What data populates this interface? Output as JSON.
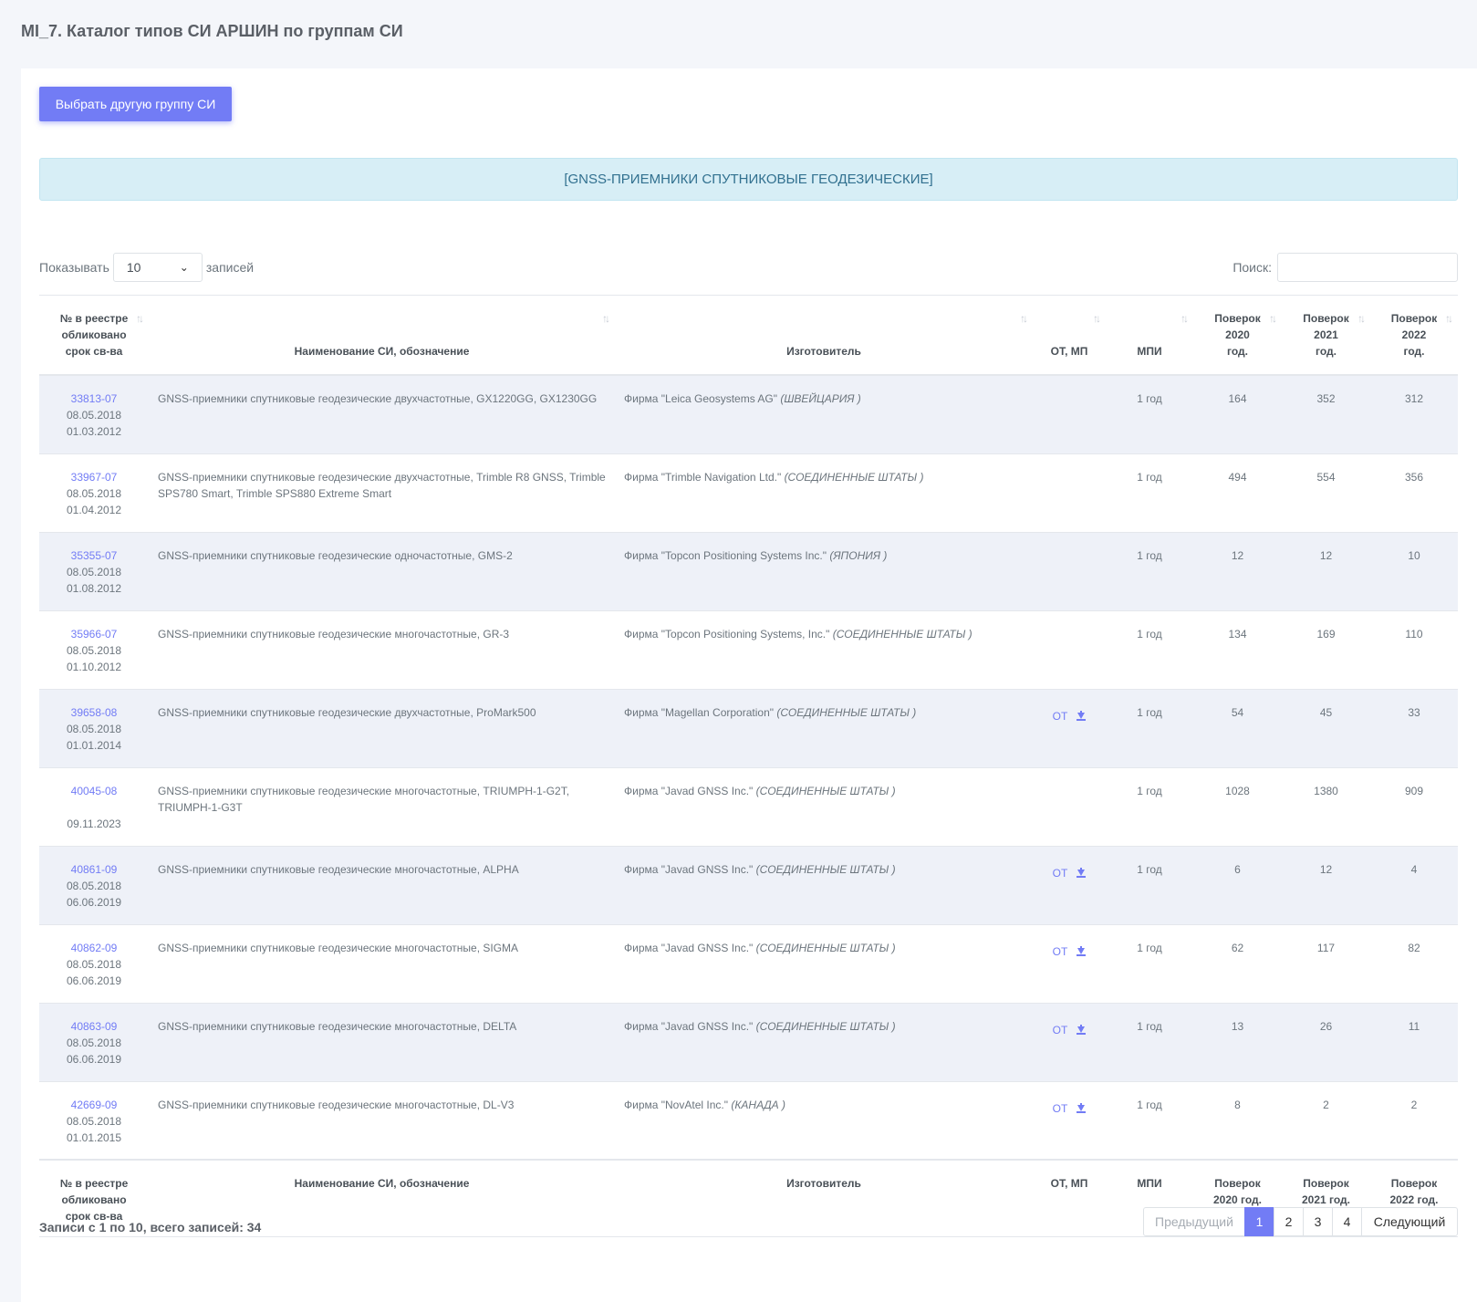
{
  "page_title": "MI_7. Каталог типов СИ АРШИН по группам СИ",
  "choose_button": "Выбрать другую группу СИ",
  "group_banner": "[GNSS-ПРИЕМНИКИ СПУТНИКОВЫЕ ГЕОДЕЗИЧЕСКИЕ]",
  "length": {
    "show_label": "Показывать",
    "value": "10",
    "entries_label": "записей"
  },
  "search": {
    "label": "Поиск:",
    "value": ""
  },
  "columns": {
    "reg_line1": "№ в реестре",
    "reg_line2": "обликовано",
    "reg_line3": "срок св-ва",
    "name": "Наименование СИ, обозначение",
    "maker": "Изготовитель",
    "ot": "ОТ, МП",
    "mpi": "МПИ",
    "p2020_line1": "Поверок",
    "p2020_line2": "2020",
    "p2020_line3": "год.",
    "p2021_line1": "Поверок",
    "p2021_line2": "2021",
    "p2021_line3": "год.",
    "p2022_line1": "Поверок",
    "p2022_line2": "2022",
    "p2022_line3": "год.",
    "foot_p2020": "2020 год.",
    "foot_p2021": "2021 год.",
    "foot_p2022": "2022 год."
  },
  "rows": [
    {
      "reg": "33813-07",
      "published": "08.05.2018",
      "valid": "01.03.2012",
      "name": "GNSS-приемники спутниковые геодезические двухчастотные, GX1220GG, GX1230GG",
      "maker": "Фирма \"Leica Geosystems AG\"",
      "country": "(ШВЕЙЦАРИЯ )",
      "ot": "",
      "mpi": "1 год",
      "p2020": "164",
      "p2021": "352",
      "p2022": "312"
    },
    {
      "reg": "33967-07",
      "published": "08.05.2018",
      "valid": "01.04.2012",
      "name": "GNSS-приемники спутниковые геодезические двухчастотные, Trimble R8 GNSS, Trimble SPS780 Smart, Trimble SPS880 Extreme Smart",
      "maker": "Фирма \"Trimble Navigation Ltd.\"",
      "country": "(СОЕДИНЕННЫЕ ШТАТЫ )",
      "ot": "",
      "mpi": "1 год",
      "p2020": "494",
      "p2021": "554",
      "p2022": "356"
    },
    {
      "reg": "35355-07",
      "published": "08.05.2018",
      "valid": "01.08.2012",
      "name": "GNSS-приемники спутниковые геодезические одночастотные, GMS-2",
      "maker": "Фирма \"Topcon Positioning Systems Inc.\"",
      "country": "(ЯПОНИЯ )",
      "ot": "",
      "mpi": "1 год",
      "p2020": "12",
      "p2021": "12",
      "p2022": "10"
    },
    {
      "reg": "35966-07",
      "published": "08.05.2018",
      "valid": "01.10.2012",
      "name": "GNSS-приемники спутниковые геодезические многочастотные, GR-3",
      "maker": "Фирма \"Topcon Positioning Systems, Inc.\"",
      "country": "(СОЕДИНЕННЫЕ ШТАТЫ )",
      "ot": "",
      "mpi": "1 год",
      "p2020": "134",
      "p2021": "169",
      "p2022": "110"
    },
    {
      "reg": "39658-08",
      "published": "08.05.2018",
      "valid": "01.01.2014",
      "name": "GNSS-приемники спутниковые геодезические двухчастотные, ProMark500",
      "maker": "Фирма \"Magellan Corporation\"",
      "country": "(СОЕДИНЕННЫЕ ШТАТЫ )",
      "ot": "ОТ",
      "mpi": "1 год",
      "p2020": "54",
      "p2021": "45",
      "p2022": "33"
    },
    {
      "reg": "40045-08",
      "published": "",
      "valid": "09.11.2023",
      "name": "GNSS-приемники спутниковые геодезические многочастотные, TRIUMPH-1-G2T, TRIUMPH-1-G3T",
      "maker": "Фирма \"Javad GNSS Inc.\"",
      "country": "(СОЕДИНЕННЫЕ ШТАТЫ )",
      "ot": "",
      "mpi": "1 год",
      "p2020": "1028",
      "p2021": "1380",
      "p2022": "909"
    },
    {
      "reg": "40861-09",
      "published": "08.05.2018",
      "valid": "06.06.2019",
      "name": "GNSS-приемники спутниковые геодезические многочастотные, ALPHA",
      "maker": "Фирма \"Javad GNSS Inc.\"",
      "country": "(СОЕДИНЕННЫЕ ШТАТЫ )",
      "ot": "ОТ",
      "mpi": "1 год",
      "p2020": "6",
      "p2021": "12",
      "p2022": "4"
    },
    {
      "reg": "40862-09",
      "published": "08.05.2018",
      "valid": "06.06.2019",
      "name": "GNSS-приемники спутниковые геодезические многочастотные, SIGMA",
      "maker": "Фирма \"Javad GNSS Inc.\"",
      "country": "(СОЕДИНЕННЫЕ ШТАТЫ )",
      "ot": "ОТ",
      "mpi": "1 год",
      "p2020": "62",
      "p2021": "117",
      "p2022": "82"
    },
    {
      "reg": "40863-09",
      "published": "08.05.2018",
      "valid": "06.06.2019",
      "name": "GNSS-приемники спутниковые геодезические многочастотные, DELTA",
      "maker": "Фирма \"Javad GNSS Inc.\"",
      "country": "(СОЕДИНЕННЫЕ ШТАТЫ )",
      "ot": "ОТ",
      "mpi": "1 год",
      "p2020": "13",
      "p2021": "26",
      "p2022": "11"
    },
    {
      "reg": "42669-09",
      "published": "08.05.2018",
      "valid": "01.01.2015",
      "name": "GNSS-приемники спутниковые геодезические многочастотные, DL-V3",
      "maker": "Фирма \"NovAtel Inc.\"",
      "country": "(КАНАДА )",
      "ot": "ОТ",
      "mpi": "1 год",
      "p2020": "8",
      "p2021": "2",
      "p2022": "2"
    }
  ],
  "info_text": "Записи с 1 по 10, всего записей: 34",
  "pagination": {
    "prev": "Предыдущий",
    "pages": [
      "1",
      "2",
      "3",
      "4"
    ],
    "active": "1",
    "next": "Следующий"
  },
  "colors": {
    "accent": "#727cf5",
    "banner_bg": "#d7eef6",
    "stripe": "#eef1f8"
  },
  "icons": {
    "sort": "sort-arrows-icon",
    "download": "download-icon",
    "dropdown": "chevron-down-icon"
  }
}
